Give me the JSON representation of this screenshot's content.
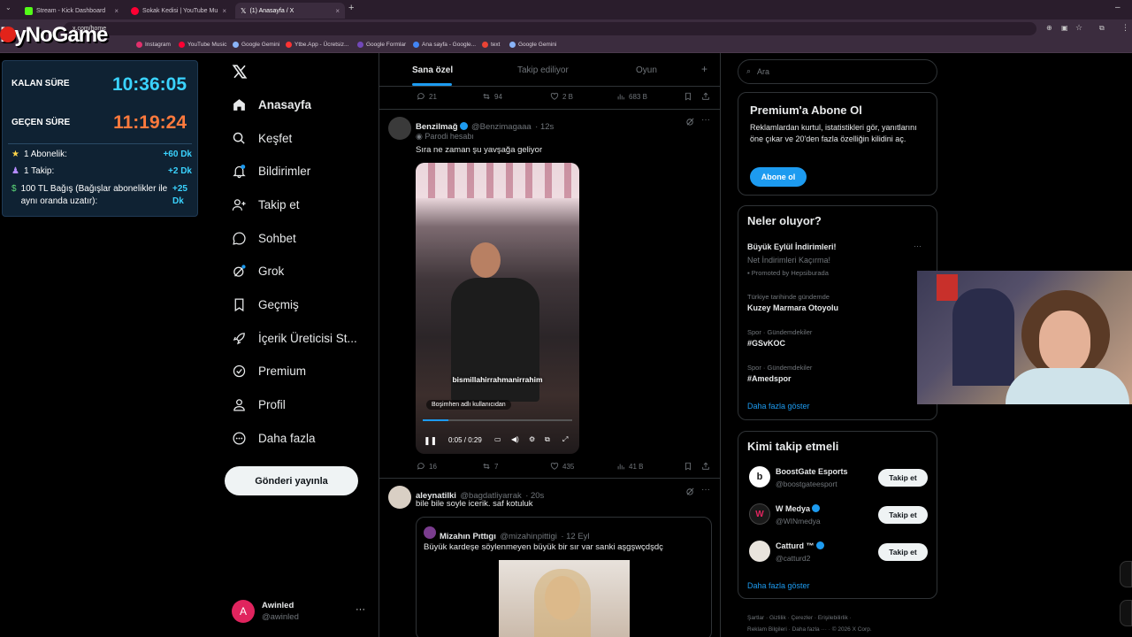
{
  "browser": {
    "tabs": [
      {
        "title": "Stream - Kick Dashboard",
        "color": "#53fc18"
      },
      {
        "title": "Sokak Kedisi | YouTube Mu",
        "color": "#ff0033"
      },
      {
        "title": "(1) Anasayfa / X",
        "color": "#ffffff"
      }
    ],
    "url": "x.com/home",
    "bookmarks": [
      {
        "label": "Instagram",
        "color": "#e1306c"
      },
      {
        "label": "YouTube Music",
        "color": "#ff0033"
      },
      {
        "label": "Google Gemini",
        "color": "#8ab4f8"
      },
      {
        "label": "Ytbe.App - Ücretsiz...",
        "color": "#ff3333"
      },
      {
        "label": "Google Formlar",
        "color": "#7248b9"
      },
      {
        "label": "Ana sayfa - Google...",
        "color": "#4285f4"
      },
      {
        "label": "text",
        "color": "#ea4335"
      },
      {
        "label": "Google Gemini",
        "color": "#8ab4f8"
      }
    ]
  },
  "overlay": {
    "logo_main": "ByNo",
    "logo_accent": "Game",
    "remaining_label": "KALAN SÜRE",
    "remaining_value": "10:36:05",
    "elapsed_label": "GEÇEN SÜRE",
    "elapsed_value": "11:19:24",
    "rules": [
      {
        "label": "1 Abonelik:",
        "value": "+60 Dk"
      },
      {
        "label": "1 Takip:",
        "value": "+2 Dk"
      },
      {
        "label": "100 TL Bağış (Bağışlar abonelikler ile aynı oranda uzatır):",
        "value": "+25 Dk"
      }
    ]
  },
  "nav": {
    "items": [
      {
        "label": "Anasayfa",
        "icon": "home-icon"
      },
      {
        "label": "Keşfet",
        "icon": "search-icon"
      },
      {
        "label": "Bildirimler",
        "icon": "bell-icon"
      },
      {
        "label": "Takip et",
        "icon": "follow-icon"
      },
      {
        "label": "Sohbet",
        "icon": "chat-icon"
      },
      {
        "label": "Grok",
        "icon": "grok-icon"
      },
      {
        "label": "Geçmiş",
        "icon": "bookmark-icon"
      },
      {
        "label": "İçerik Üreticisi St...",
        "icon": "rocket-icon"
      },
      {
        "label": "Premium",
        "icon": "premium-icon"
      },
      {
        "label": "Profil",
        "icon": "person-icon"
      },
      {
        "label": "Daha fazla",
        "icon": "more-icon"
      }
    ],
    "post_button": "Gönderi yayınla",
    "account": {
      "name": "Awinled",
      "handle": "@awinled",
      "initial": "A"
    }
  },
  "feed": {
    "tabs": [
      "Sana özel",
      "Takip ediliyor",
      "Oyun"
    ],
    "prev_actions": {
      "replies": "21",
      "reposts": "94",
      "likes": "2 B",
      "views": "683 B"
    },
    "tweet1": {
      "name": "Benzilmağ",
      "handle": "@Benzimagaaa",
      "time": "· 12s",
      "label": "Parodi hesabı",
      "text": "Sıra ne zaman şu yavşağa geliyor",
      "video_caption": "bismillahirrahmanirrahim",
      "video_tag": "Boşimhen adlı kullanıcıdan",
      "video_time": "0:05 / 0:29",
      "actions": {
        "replies": "16",
        "reposts": "7",
        "likes": "435",
        "views": "41 B"
      }
    },
    "tweet2": {
      "name": "aleynatilki",
      "handle": "@bagdatliyarrak",
      "time": "· 20s",
      "text": "bile bile soyle icerik. saf kotuluk",
      "quote": {
        "name": "Mizahın Pıttıgı",
        "handle": "@mizahinpittigi",
        "time": "· 12 Eyl",
        "text": "Büyük kardeşe söylenmeyen büyük bir sır var sanki aşgşwçdşdç"
      }
    }
  },
  "right": {
    "search_placeholder": "Ara",
    "premium": {
      "title": "Premium'a Abone Ol",
      "text": "Reklamlardan kurtul, istatistikleri gör, yanıtlarını öne çıkar ve 20'den fazla özelliğin kilidini aç.",
      "button": "Abone ol"
    },
    "trends": {
      "title": "Neler oluyor?",
      "promo_name": "Büyük Eylül İndirimleri!",
      "promo_sub": "Net İndirimleri Kaçırma!",
      "promo_by": "Promoted by Hepsiburada",
      "items": [
        {
          "meta": "Türkiye tarihinde gündemde",
          "name": "Kuzey Marmara Otoyolu"
        },
        {
          "meta": "Spor · Gündemdekiler",
          "name": "#GSvKOC"
        },
        {
          "meta": "Spor · Gündemdekiler",
          "name": "#Amedspor"
        }
      ],
      "more": "Daha fazla göster"
    },
    "who_to_follow": {
      "title": "Kimi takip etmeli",
      "accounts": [
        {
          "name": "BoostGate Esports",
          "handle": "@boostgateesport",
          "verified": false
        },
        {
          "name": "W Medya",
          "handle": "@WINmedya",
          "verified": true
        },
        {
          "name": "Catturd ™",
          "handle": "@catturd2",
          "verified": true
        }
      ],
      "button": "Takip et",
      "more": "Daha fazla göster"
    },
    "footer": [
      "Şartlar",
      "Gizlilik",
      "Çerezler",
      "Erişilebilirlik",
      "Reklam Bilgileri",
      "Daha fazla ···",
      "© 2026 X Corp."
    ]
  }
}
